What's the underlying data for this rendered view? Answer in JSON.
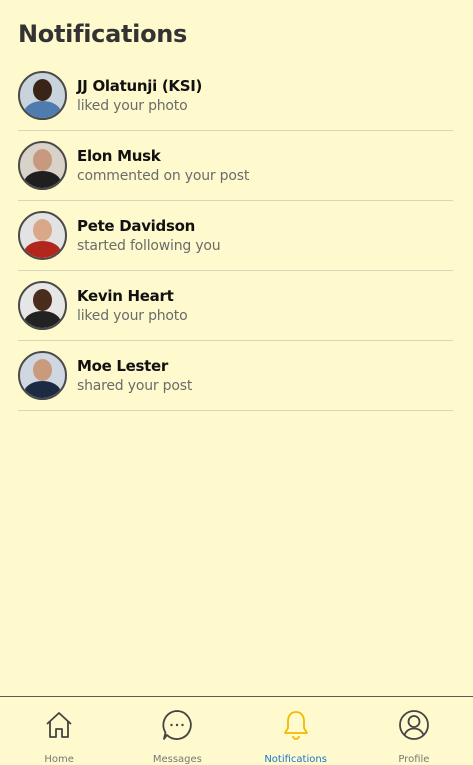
{
  "header": {
    "title": "Notifications"
  },
  "notifications": [
    {
      "name": "JJ Olatunji (KSI)",
      "action": "liked your photo"
    },
    {
      "name": "Elon Musk",
      "action": "commented on your post"
    },
    {
      "name": "Pete Davidson",
      "action": "started following you"
    },
    {
      "name": "Kevin Heart",
      "action": "liked your photo"
    },
    {
      "name": "Moe Lester",
      "action": "shared your post"
    }
  ],
  "tabbar": {
    "tabs": [
      {
        "label": "Home",
        "icon": "home-icon",
        "active": false
      },
      {
        "label": "Messages",
        "icon": "chat-bubble-icon",
        "active": false
      },
      {
        "label": "Notifications",
        "icon": "bell-icon",
        "active": true
      },
      {
        "label": "Profile",
        "icon": "user-circle-icon",
        "active": false
      }
    ]
  },
  "colors": {
    "background": "#fffacd",
    "active_tab_label": "#1877d2",
    "active_tab_icon": "#f5b800",
    "inactive_tab": "#444444"
  }
}
